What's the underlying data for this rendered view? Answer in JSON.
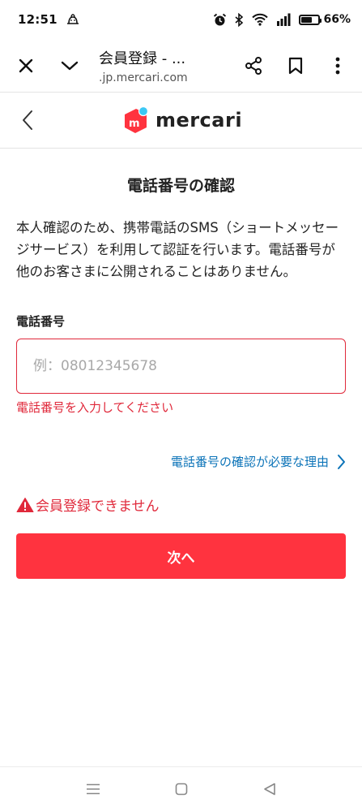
{
  "status_bar": {
    "time": "12:51",
    "battery_percent": "66%",
    "battery_level": 0.66,
    "icons": [
      "notification-icon",
      "alarm-icon",
      "bluetooth-icon",
      "wifi-icon",
      "signal-icon",
      "battery-icon"
    ]
  },
  "browser": {
    "page_title": "会員登録 - ...",
    "url": ".jp.mercari.com"
  },
  "site_header": {
    "logo_text": "mercari",
    "logo_color": "#ff333f",
    "logo_dot_color": "#3cc8f5"
  },
  "main": {
    "title": "電話番号の確認",
    "description": "本人確認のため、携帯電話のSMS（ショートメッセージサービス）を利用して認証を行います。電話番号が他のお客さまに公開されることはありません。",
    "field_label": "電話番号",
    "input_placeholder": "例：08012345678",
    "input_value": "",
    "field_error": "電話番号を入力してください",
    "reason_link": "電話番号の確認が必要な理由",
    "form_error": "会員登録できません",
    "next_button": "次へ"
  },
  "colors": {
    "error": "#e0293b",
    "primary_button": "#ff333f",
    "link": "#0b73b8"
  }
}
